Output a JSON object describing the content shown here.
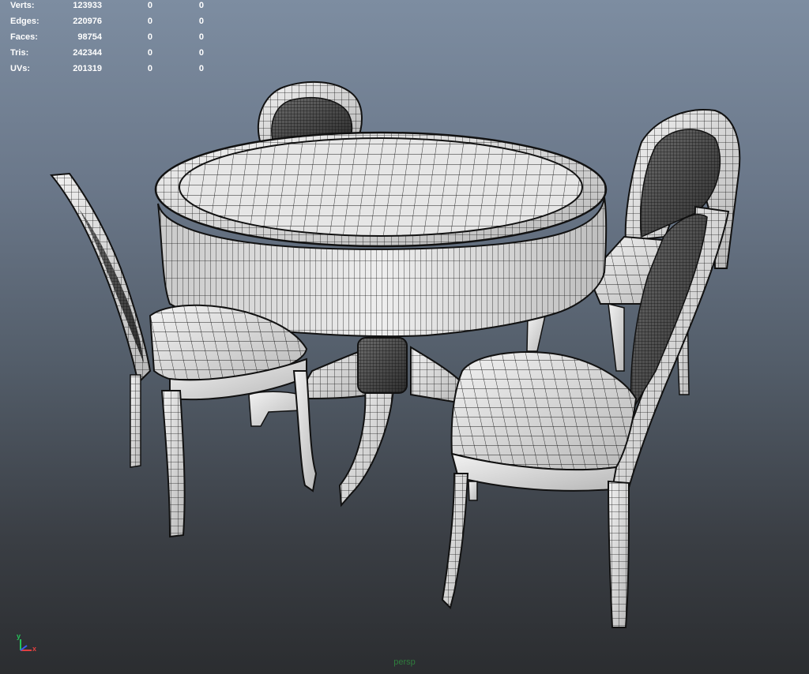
{
  "viewport": {
    "camera": "persp",
    "heads_up_display": {
      "rows": [
        {
          "label": "Verts:",
          "total": "123933",
          "selected": "0",
          "component": "0"
        },
        {
          "label": "Edges:",
          "total": "220976",
          "selected": "0",
          "component": "0"
        },
        {
          "label": "Faces:",
          "total": "98754",
          "selected": "0",
          "component": "0"
        },
        {
          "label": "Tris:",
          "total": "242344",
          "selected": "0",
          "component": "0"
        },
        {
          "label": "UVs:",
          "total": "201319",
          "selected": "0",
          "component": "0"
        }
      ]
    },
    "axis_indicator": {
      "y": "y",
      "x": "x"
    },
    "scene": {
      "display_mode": "wireframe-on-shaded",
      "objects": [
        "dining-table",
        "chair-back-left",
        "chair-back-right",
        "chair-front-left",
        "chair-front-right"
      ]
    },
    "colors": {
      "label_text": "#ffffff",
      "camera_label": "#2f7c3d",
      "axis_x": "#e04040",
      "axis_y": "#25c45a",
      "axis_z": "#3a5cf0"
    }
  }
}
